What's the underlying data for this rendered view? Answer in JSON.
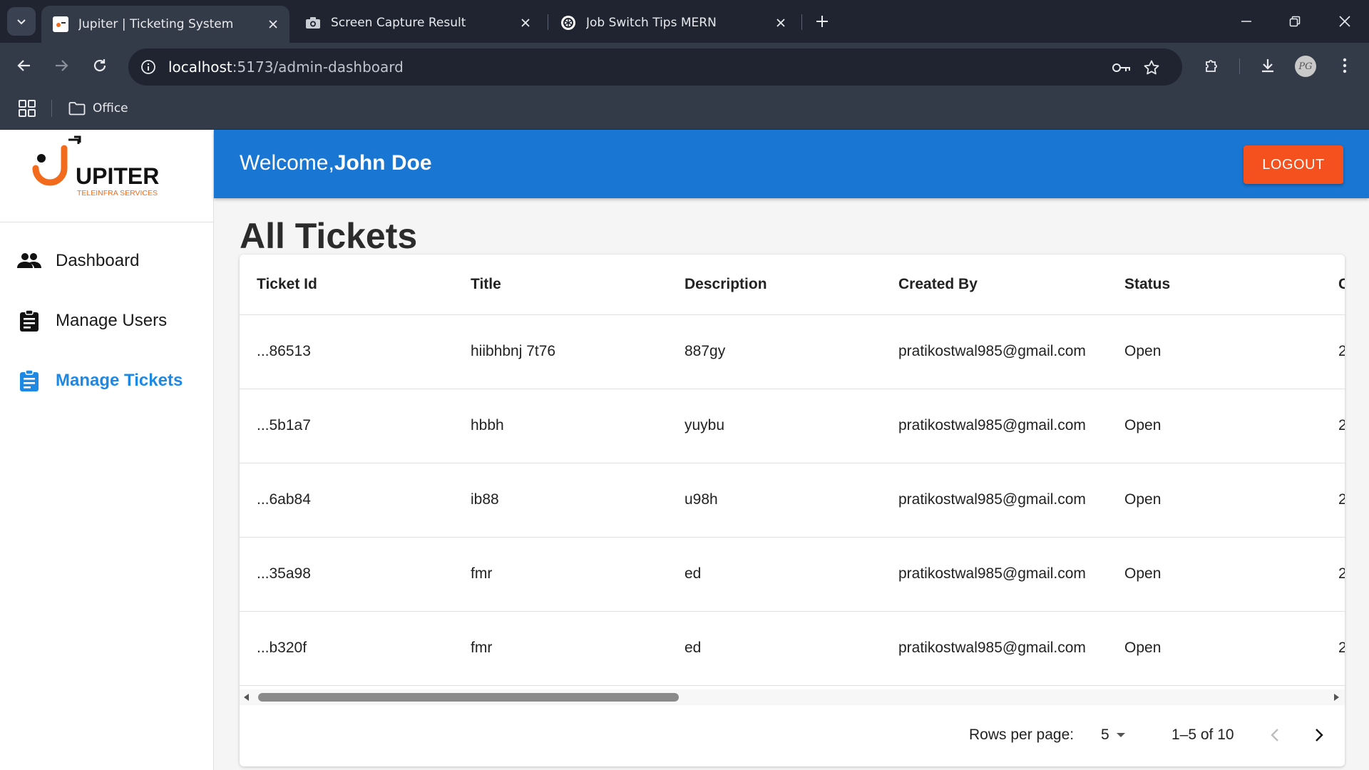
{
  "browser": {
    "tabs": [
      {
        "title": "Jupiter | Ticketing System",
        "active": true
      },
      {
        "title": "Screen Capture Result",
        "active": false
      },
      {
        "title": "Job Switch Tips MERN",
        "active": false
      }
    ],
    "url_host": "localhost",
    "url_path": ":5173/admin-dashboard",
    "bookmarks": [
      {
        "label": "Office"
      }
    ]
  },
  "sidebar": {
    "logo": {
      "name": "UPITER",
      "tagline": "TELEINFRA SERVICES"
    },
    "items": [
      {
        "label": "Dashboard",
        "icon": "people-icon",
        "active": false
      },
      {
        "label": "Manage Users",
        "icon": "clipboard-icon",
        "active": false
      },
      {
        "label": "Manage Tickets",
        "icon": "assignment-icon",
        "active": true
      }
    ]
  },
  "appbar": {
    "welcome_prefix": "Welcome,",
    "user_name": "John Doe",
    "logout_label": "LOGOUT"
  },
  "page": {
    "title": "All Tickets"
  },
  "table": {
    "columns": [
      "Ticket Id",
      "Title",
      "Description",
      "Created By",
      "Status",
      "C"
    ],
    "rows": [
      [
        "...86513",
        "hiibhbnj 7t76",
        "887gy",
        "pratikostwal985@gmail.com",
        "Open",
        "2"
      ],
      [
        "...5b1a7",
        "hbbh",
        "yuybu",
        "pratikostwal985@gmail.com",
        "Open",
        "2"
      ],
      [
        "...6ab84",
        "ib88",
        "u98h",
        "pratikostwal985@gmail.com",
        "Open",
        "2"
      ],
      [
        "...35a98",
        "fmr",
        "ed",
        "pratikostwal985@gmail.com",
        "Open",
        "2"
      ],
      [
        "...b320f",
        "fmr",
        "ed",
        "pratikostwal985@gmail.com",
        "Open",
        "2"
      ]
    ]
  },
  "pagination": {
    "rows_per_page_label": "Rows per page:",
    "rows_per_page_value": "5",
    "range_label": "1–5 of 10"
  },
  "colors": {
    "appbar": "#1976d2",
    "logout": "#f4511e",
    "active_nav": "#1e88e5",
    "logo_orange": "#f26b1d"
  }
}
